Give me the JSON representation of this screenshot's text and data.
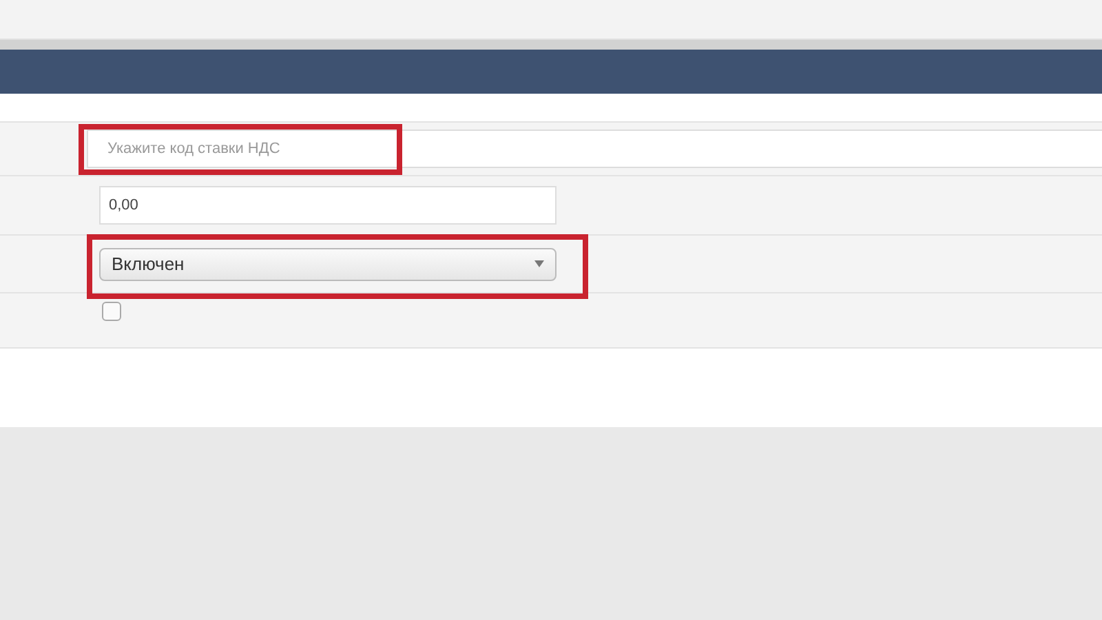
{
  "form": {
    "fields": [
      {
        "kind": "text",
        "placeholder": "Укажите код ставки НДС",
        "highlighted": true,
        "wide": true
      },
      {
        "kind": "text",
        "value": "0,00",
        "highlighted": false,
        "wide": false
      },
      {
        "kind": "select",
        "value": "Включен",
        "highlighted": true
      },
      {
        "kind": "checkbox",
        "checked": false,
        "highlighted": false
      }
    ]
  }
}
